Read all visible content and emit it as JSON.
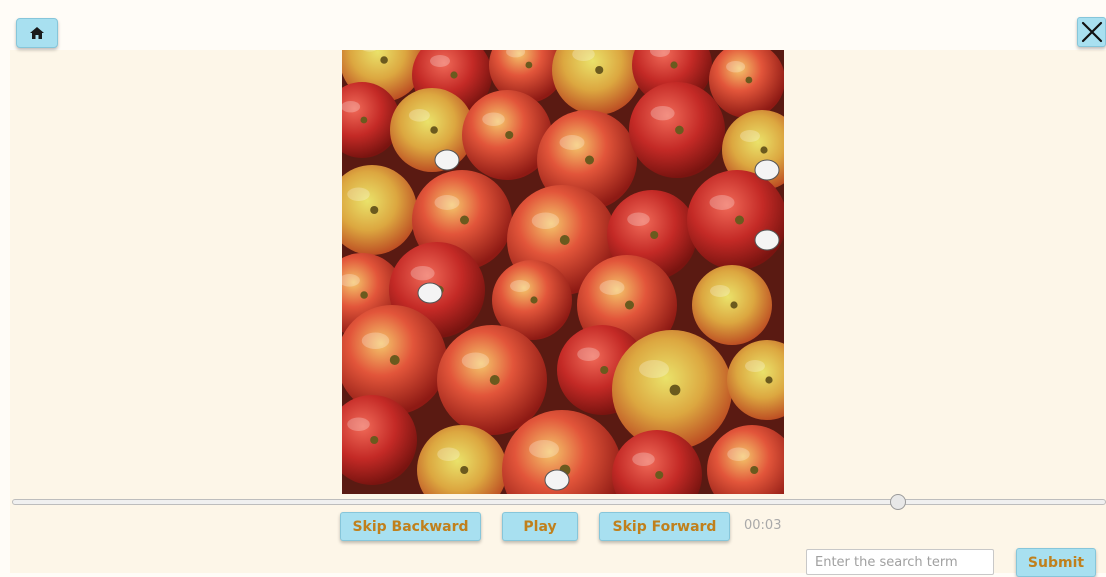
{
  "toolbar": {
    "home_icon": "home-icon",
    "close_icon": "close-icon"
  },
  "media": {
    "image_icon": "apples-photo",
    "progress": 0.81
  },
  "controls": {
    "skip_backward_label": "Skip Backward",
    "play_label": "Play",
    "skip_forward_label": "Skip Forward",
    "time": "00:03"
  },
  "search": {
    "placeholder": "Enter the search term",
    "value": "",
    "submit_label": "Submit"
  },
  "colors": {
    "button_bg": "#a8e0f0",
    "button_text": "#c0801c",
    "stage_bg": "#fdf6e8"
  }
}
